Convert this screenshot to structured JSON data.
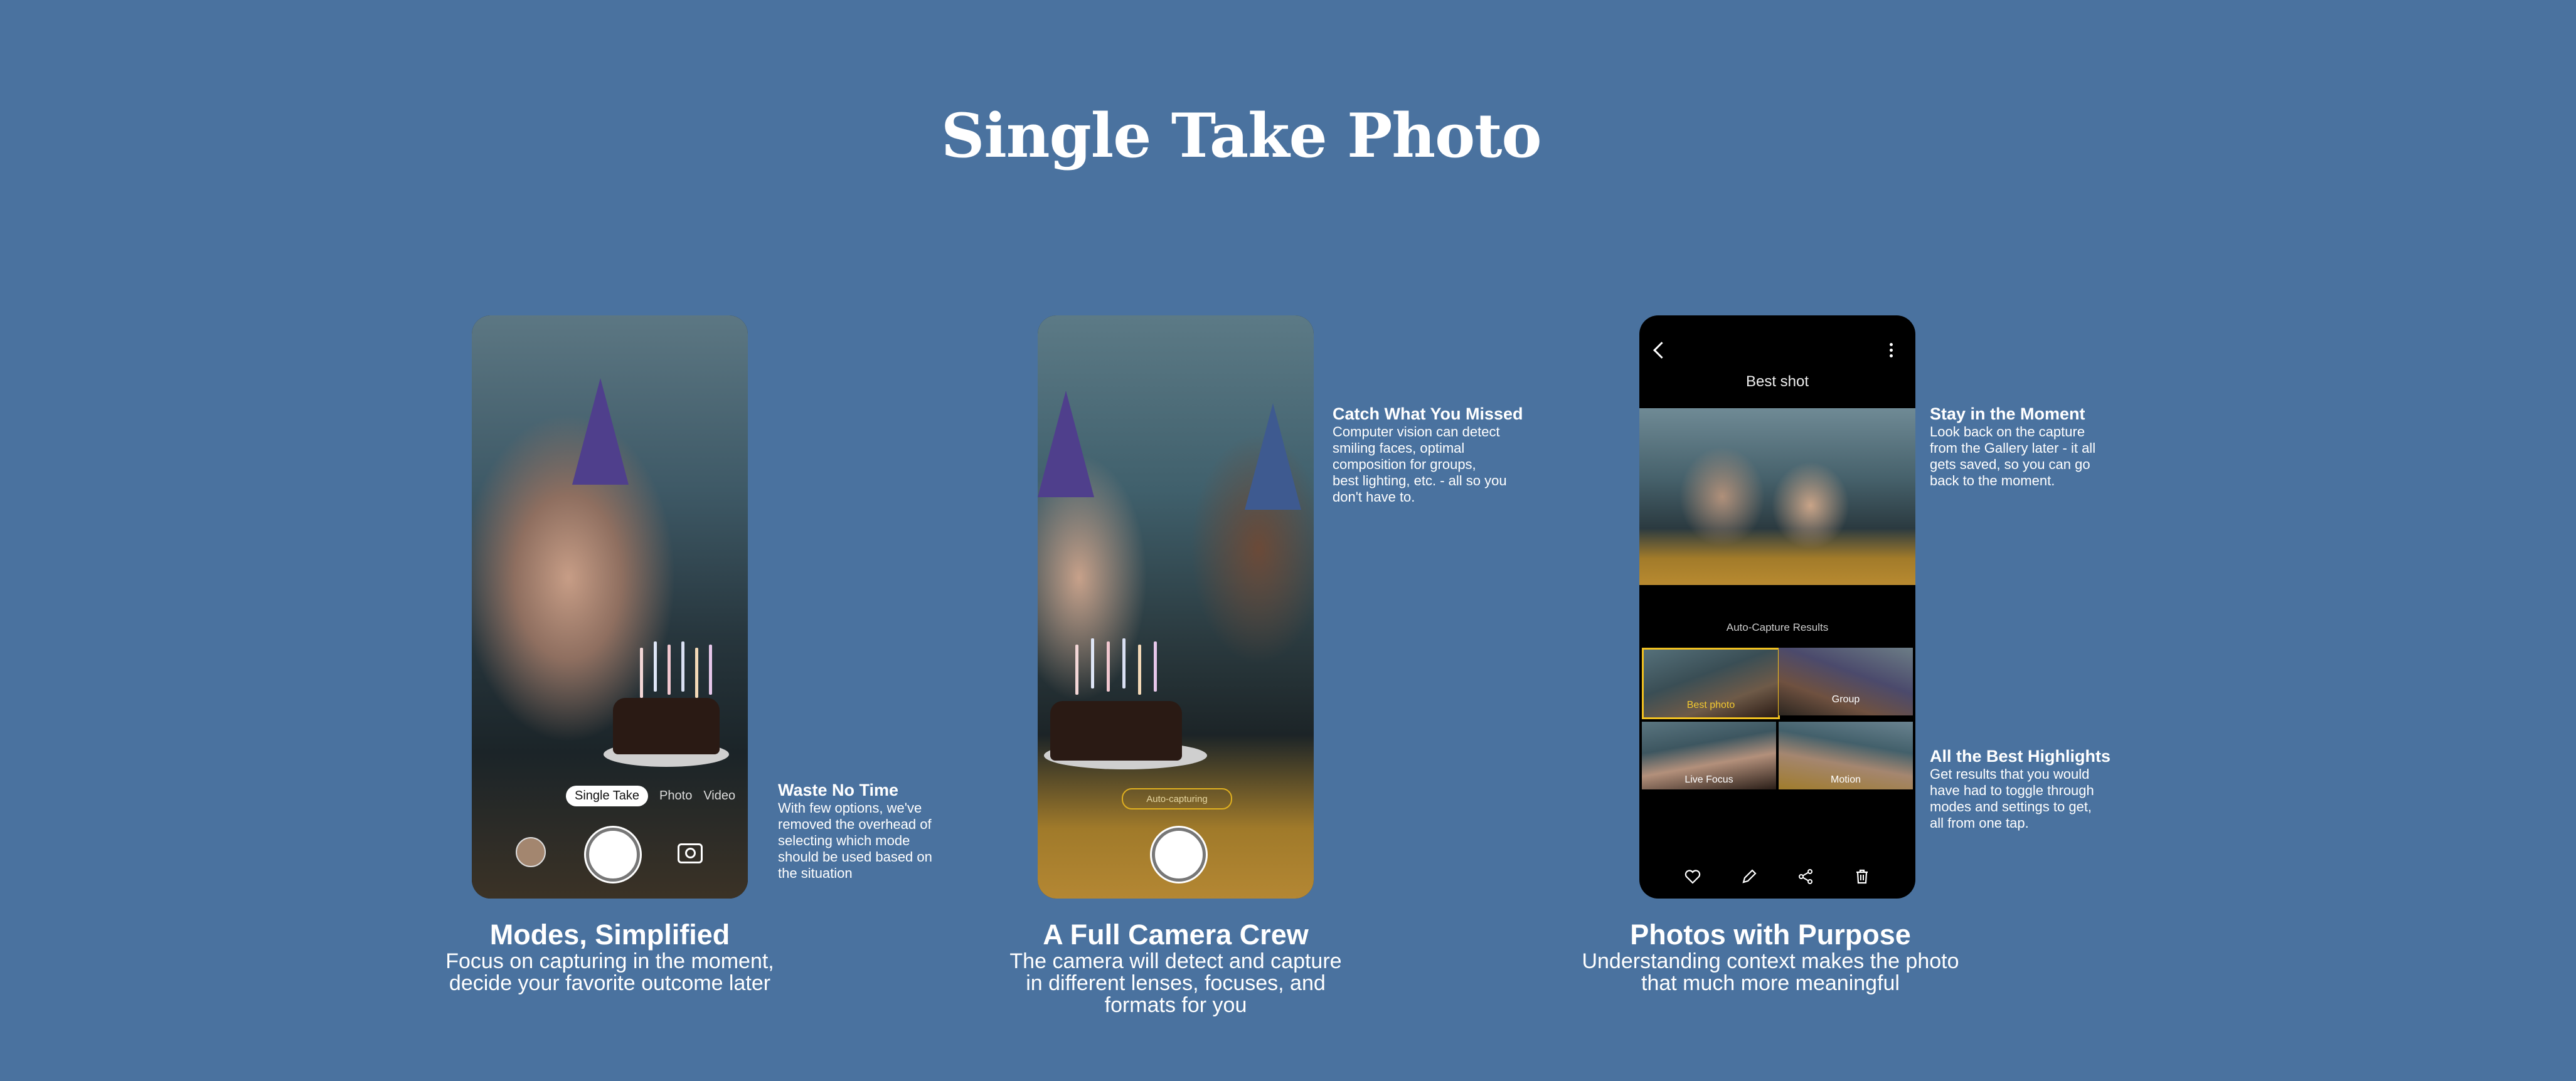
{
  "page_title": "Single Take Photo",
  "phone1": {
    "mode_active": "Single Take",
    "modes": [
      "Photo",
      "Video"
    ]
  },
  "phone2": {
    "status_pill": "Auto-capturing"
  },
  "phone3": {
    "header_title": "Best shot",
    "results_label": "Auto-Capture Results",
    "thumbnails": [
      {
        "label": "Best photo",
        "selected": true
      },
      {
        "label": "Group",
        "selected": false
      },
      {
        "label": "Live Focus",
        "selected": false
      },
      {
        "label": "Motion",
        "selected": false
      }
    ],
    "actions": [
      "heart-icon",
      "pencil-icon",
      "share-icon",
      "trash-icon"
    ]
  },
  "callouts": {
    "waste_no_time": {
      "heading": "Waste No Time",
      "lines": [
        "With few options, we've",
        "removed the overhead of",
        "selecting which mode",
        "should be used based on",
        "the situation"
      ]
    },
    "catch_what_you_missed": {
      "heading": "Catch What You Missed",
      "lines": [
        "Computer vision can detect",
        "smiling faces, optimal",
        "composition for groups,",
        "best lighting, etc. - all so you",
        "don't have to."
      ]
    },
    "stay_in_the_moment": {
      "heading": "Stay in the Moment",
      "lines": [
        "Look back on the capture",
        "from the Gallery later - it all",
        "gets saved, so you can go",
        "back to the moment."
      ]
    },
    "all_the_best_highlights": {
      "heading": "All the Best Highlights",
      "lines": [
        "Get results that you would",
        "have had to toggle through",
        "modes and settings to get,",
        "all from one tap."
      ]
    }
  },
  "sections": [
    {
      "heading": "Modes, Simplified",
      "lines": [
        "Focus on capturing in the moment,",
        "decide your favorite outcome later"
      ]
    },
    {
      "heading": "A Full Camera Crew",
      "lines": [
        "The camera will detect and capture",
        "in different lenses, focuses, and",
        "formats for you"
      ]
    },
    {
      "heading": "Photos with Purpose",
      "lines": [
        "Understanding context makes the photo",
        "that much more meaningful"
      ]
    }
  ],
  "colors": {
    "background": "#4a729f",
    "highlight": "#f0c020"
  }
}
